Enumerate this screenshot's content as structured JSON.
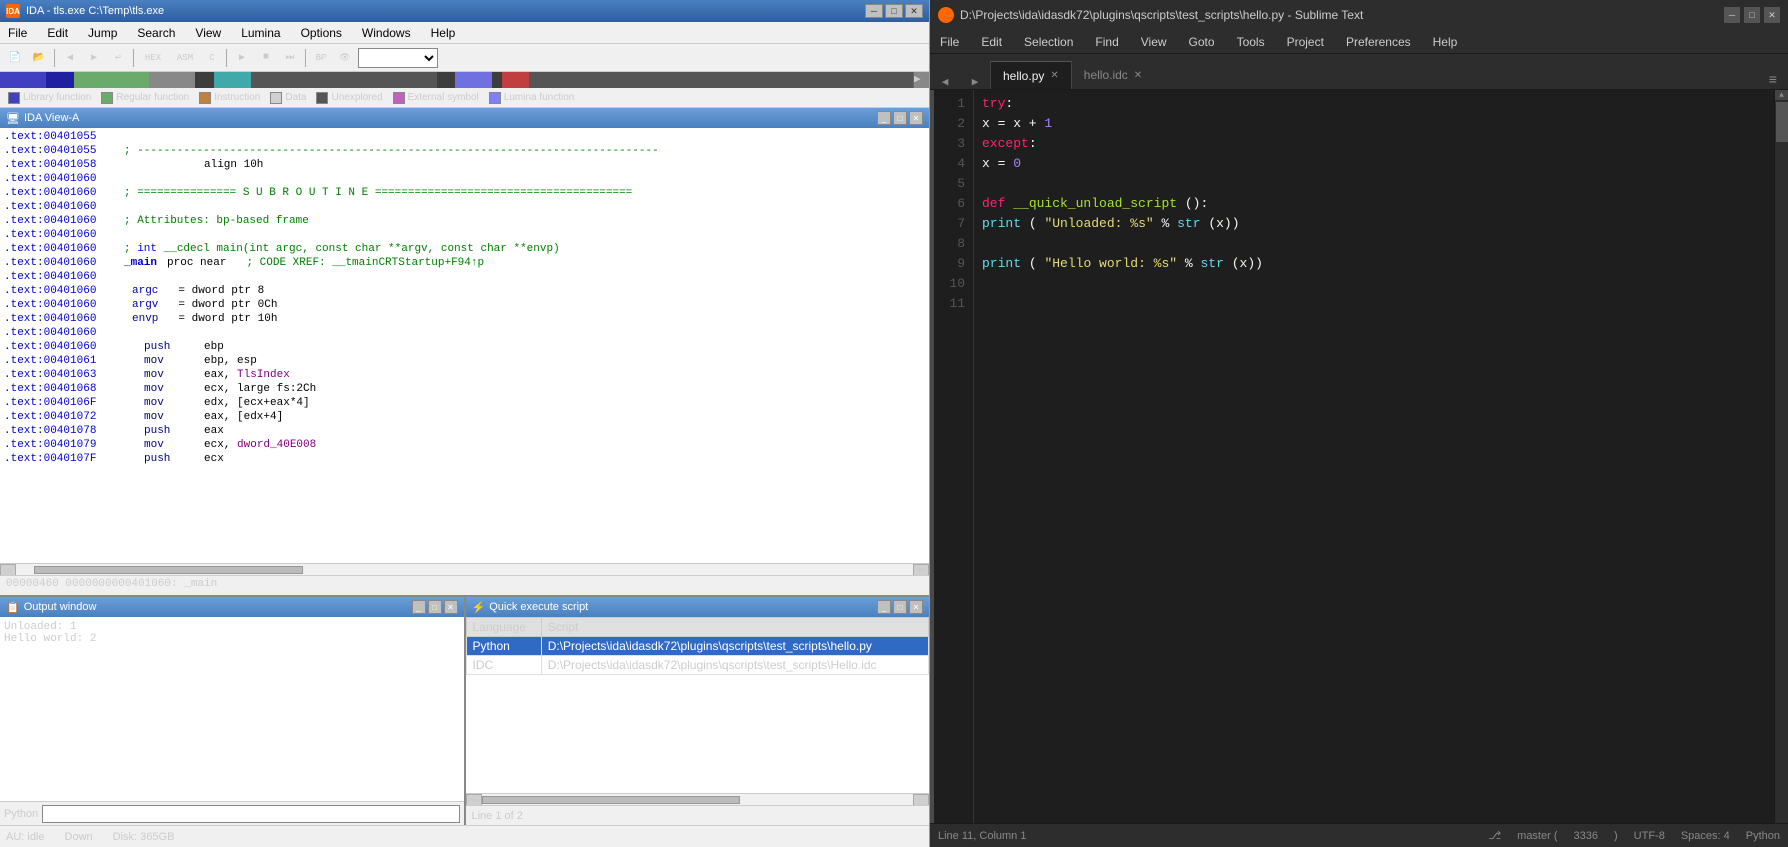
{
  "ida": {
    "title": "IDA - tls.exe C:\\Temp\\tls.exe",
    "icon": "IDA",
    "menu": [
      "File",
      "Edit",
      "Jump",
      "Search",
      "View",
      "Lumina",
      "Options",
      "Windows",
      "Help"
    ],
    "view_title": "IDA View-A",
    "legend": [
      {
        "label": "Library function",
        "color": "#4040c0"
      },
      {
        "label": "Regular function",
        "color": "#6aaa6a"
      },
      {
        "label": "Instruction",
        "color": "#c08040"
      },
      {
        "label": "Data",
        "color": "#d0d0d0"
      },
      {
        "label": "Unexplored",
        "color": "#555555"
      },
      {
        "label": "External symbol",
        "color": "#c060c0"
      },
      {
        "label": "Lumina function",
        "color": "#8080ff"
      }
    ],
    "code_lines": [
      {
        "addr": ".text:00401055",
        "text": ""
      },
      {
        "addr": ".text:00401055",
        "text": "; -------------------------------------------------------------------------------"
      },
      {
        "addr": ".text:00401058",
        "text": "                align 10h"
      },
      {
        "addr": ".text:00401060",
        "text": ""
      },
      {
        "addr": ".text:00401060",
        "text": "; =============== S U B R O U T I N E ======================================="
      },
      {
        "addr": ".text:00401060",
        "text": ""
      },
      {
        "addr": ".text:00401060",
        "text": "; Attributes: bp-based frame"
      },
      {
        "addr": ".text:00401060",
        "text": ""
      },
      {
        "addr": ".text:00401060",
        "text": "; int __cdecl main(int argc, const char **argv, const char **envp)"
      },
      {
        "addr": ".text:00401060",
        "text": "_main           proc near               ; CODE XREF: __tmainCRTStartup+F94↑p"
      },
      {
        "addr": ".text:00401060",
        "text": ""
      },
      {
        "addr": ".text:00401060",
        "text": "argc            = dword ptr  8"
      },
      {
        "addr": ".text:00401060",
        "text": "argv            = dword ptr  0Ch"
      },
      {
        "addr": ".text:00401060",
        "text": "envp            = dword ptr  10h"
      },
      {
        "addr": ".text:00401060",
        "text": ""
      },
      {
        "addr": ".text:00401060",
        "instr": "push",
        "operand": "    ebp"
      },
      {
        "addr": ".text:00401061",
        "instr": "mov",
        "operand": "     ebp, esp"
      },
      {
        "addr": ".text:00401063",
        "instr": "mov",
        "operand": "     eax, TlsIndex"
      },
      {
        "addr": ".text:00401068",
        "instr": "mov",
        "operand": "     ecx, large fs:2Ch"
      },
      {
        "addr": ".text:0040106F",
        "instr": "mov",
        "operand": "     edx, [ecx+eax*4]"
      },
      {
        "addr": ".text:00401072",
        "instr": "mov",
        "operand": "     eax, [edx+4]"
      },
      {
        "addr": ".text:00401078",
        "instr": "push",
        "operand": "    eax"
      },
      {
        "addr": ".text:00401079",
        "instr": "mov",
        "operand": "     ecx, dword_40E008"
      },
      {
        "addr": ".text:0040107F",
        "instr": "push",
        "operand": "    ecx"
      }
    ],
    "addr_bar": "00000460 0000000000401060: _main",
    "output": {
      "title": "Output window",
      "lines": [
        "Unloaded: 1",
        "Hello world: 2"
      ]
    },
    "script": {
      "title": "Quick execute script",
      "cols": [
        "Language",
        "Script"
      ],
      "rows": [
        {
          "lang": "Python",
          "script": "D:\\Projects\\ida\\idasdk72\\plugins\\qscripts\\test_scripts\\hello.py",
          "selected": true
        },
        {
          "lang": "IDC",
          "script": "D:\\Projects\\ida\\idasdk72\\plugins\\qscripts\\test_scripts\\Hello.idc",
          "selected": false
        }
      ],
      "footer": "Line 1 of 2"
    },
    "status": {
      "state": "AU: idle",
      "direction": "Down",
      "disk": "Disk: 365GB"
    }
  },
  "sublime": {
    "title": "D:\\Projects\\ida\\idasdk72\\plugins\\qscripts\\test_scripts\\hello.py - Sublime Text",
    "menu": [
      "File",
      "Edit",
      "Selection",
      "Find",
      "View",
      "Goto",
      "Tools",
      "Project",
      "Preferences",
      "Help"
    ],
    "tabs": [
      {
        "label": "hello.py",
        "active": true
      },
      {
        "label": "hello.idc",
        "active": false
      }
    ],
    "code": [
      {
        "line": 1,
        "content": [
          {
            "type": "keyword",
            "text": "try"
          },
          {
            "type": "normal",
            "text": ":"
          }
        ]
      },
      {
        "line": 2,
        "content": [
          {
            "type": "normal",
            "text": "    x = x + "
          },
          {
            "type": "number",
            "text": "1"
          }
        ]
      },
      {
        "line": 3,
        "content": [
          {
            "type": "keyword",
            "text": "except"
          },
          {
            "type": "normal",
            "text": ":"
          }
        ]
      },
      {
        "line": 4,
        "content": [
          {
            "type": "normal",
            "text": "    x = "
          },
          {
            "type": "number",
            "text": "0"
          }
        ]
      },
      {
        "line": 5,
        "content": []
      },
      {
        "line": 6,
        "content": [
          {
            "type": "keyword",
            "text": "def"
          },
          {
            "type": "normal",
            "text": " "
          },
          {
            "type": "func",
            "text": "__quick_unload_script"
          },
          {
            "type": "normal",
            "text": "():"
          }
        ]
      },
      {
        "line": 7,
        "content": [
          {
            "type": "normal",
            "text": "    "
          },
          {
            "type": "builtin",
            "text": "print"
          },
          {
            "type": "normal",
            "text": "("
          },
          {
            "type": "string",
            "text": "\"Unloaded: %s\""
          },
          {
            "type": "normal",
            "text": " % "
          },
          {
            "type": "builtin",
            "text": "str"
          },
          {
            "type": "normal",
            "text": "(x))"
          }
        ]
      },
      {
        "line": 8,
        "content": []
      },
      {
        "line": 9,
        "content": [
          {
            "type": "builtin",
            "text": "print"
          },
          {
            "type": "normal",
            "text": "("
          },
          {
            "type": "string",
            "text": "\"Hello world: %s\""
          },
          {
            "type": "normal",
            "text": " % "
          },
          {
            "type": "builtin",
            "text": "str"
          },
          {
            "type": "normal",
            "text": "(x))"
          }
        ]
      },
      {
        "line": 10,
        "content": []
      },
      {
        "line": 11,
        "content": []
      }
    ],
    "status": {
      "line_col": "Line 11, Column 1",
      "branch": "master",
      "branch_num": "3336",
      "encoding": "UTF-8",
      "spaces": "Spaces: 4",
      "language": "Python"
    }
  }
}
